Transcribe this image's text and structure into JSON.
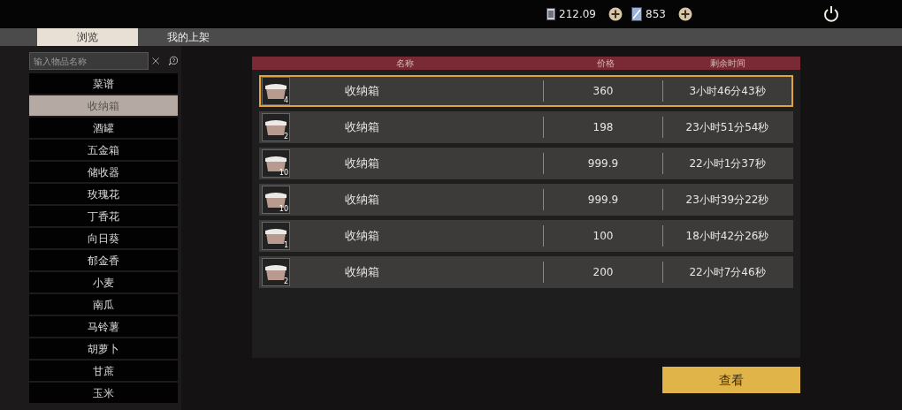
{
  "currency": [
    {
      "amount": "212.09",
      "kind": "coin"
    },
    {
      "amount": "853",
      "kind": "card"
    }
  ],
  "tabs": [
    {
      "label": "浏览",
      "selected": true
    },
    {
      "label": "我的上架",
      "selected": false
    }
  ],
  "search": {
    "placeholder": "输入物品名称"
  },
  "categories": [
    {
      "label": "菜谱",
      "selected": false
    },
    {
      "label": "收纳箱",
      "selected": true
    },
    {
      "label": "酒罐",
      "selected": false
    },
    {
      "label": "五金箱",
      "selected": false
    },
    {
      "label": "储收器",
      "selected": false
    },
    {
      "label": "玫瑰花",
      "selected": false
    },
    {
      "label": "丁香花",
      "selected": false
    },
    {
      "label": "向日葵",
      "selected": false
    },
    {
      "label": "郁金香",
      "selected": false
    },
    {
      "label": "小麦",
      "selected": false
    },
    {
      "label": "南瓜",
      "selected": false
    },
    {
      "label": "马铃薯",
      "selected": false
    },
    {
      "label": "胡萝卜",
      "selected": false
    },
    {
      "label": "甘蔗",
      "selected": false
    },
    {
      "label": "玉米",
      "selected": false
    }
  ],
  "table": {
    "columns": [
      "名称",
      "价格",
      "剩余时间"
    ],
    "rows": [
      {
        "count": "4",
        "name": "收纳箱",
        "price": "360",
        "time": "3小时46分43秒",
        "selected": true
      },
      {
        "count": "2",
        "name": "收纳箱",
        "price": "198",
        "time": "23小时51分54秒",
        "selected": false
      },
      {
        "count": "10",
        "name": "收纳箱",
        "price": "999.9",
        "time": "22小时1分37秒",
        "selected": false
      },
      {
        "count": "10",
        "name": "收纳箱",
        "price": "999.9",
        "time": "23小时39分22秒",
        "selected": false
      },
      {
        "count": "1",
        "name": "收纳箱",
        "price": "100",
        "time": "18小时42分26秒",
        "selected": false
      },
      {
        "count": "2",
        "name": "收纳箱",
        "price": "200",
        "time": "22小时7分46秒",
        "selected": false
      }
    ]
  },
  "view_button": "查看"
}
